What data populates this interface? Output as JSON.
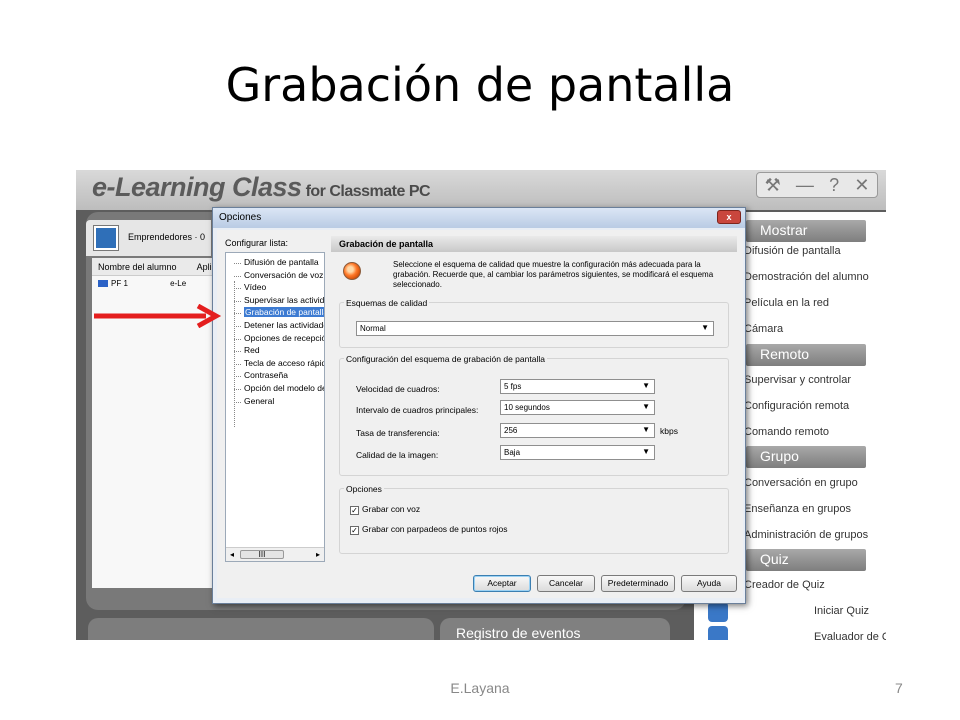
{
  "slide": {
    "title": "Grabación de pantalla",
    "author": "E.Layana",
    "page_number": "7"
  },
  "app": {
    "title_main": "e-Learning Class",
    "title_sub": "for Classmate PC",
    "controls": [
      "⚒",
      "—",
      "?",
      "✕"
    ]
  },
  "left_panel": {
    "group_label": "Emprendedores · 0",
    "columns": [
      "Nombre del alumno",
      "Apli"
    ],
    "rows": [
      {
        "name": "PF 1",
        "app": "e-Le"
      }
    ]
  },
  "bottom_tabs": {
    "events_label": "Registro de eventos"
  },
  "right_panel": {
    "sections": [
      {
        "header": "Mostrar",
        "items": [
          "Difusión de pantalla",
          "Demostración del alumno",
          "Película en la red",
          "Cámara"
        ]
      },
      {
        "header": "Remoto",
        "items": [
          "Supervisar y controlar",
          "Configuración remota",
          "Comando remoto"
        ]
      },
      {
        "header": "Grupo",
        "items": [
          "Conversación en grupo",
          "Enseñanza en grupos",
          "Administración de grupos"
        ]
      },
      {
        "header": "Quiz",
        "items": [
          "Creador de Quiz",
          "Iniciar Quiz",
          "Evaluador de Quiz"
        ]
      }
    ]
  },
  "dialog": {
    "title": "Opciones",
    "close_label": "x",
    "config_list_label": "Configurar lista:",
    "tree_items": [
      "Difusión de pantalla",
      "Conversación de voz",
      "Vídeo",
      "Supervisar las actividades",
      "Grabación de pantalla",
      "Detener las actividades",
      "Opciones de recepción",
      "Red",
      "Tecla de acceso rápido",
      "Contraseña",
      "Opción del modelo de",
      "General"
    ],
    "selected_tree_item": "Grabación de pantalla",
    "scroll_thumb": "III",
    "pane_title": "Grabación de pantalla",
    "description": "Seleccione el esquema de calidad que muestre la configuración más adecuada para la grabación. Recuerde que, al cambiar los parámetros siguientes, se modificará el esquema seleccionado.",
    "quality_group": {
      "title": "Esquemas de calidad",
      "value": "Normal"
    },
    "config_group": {
      "title": "Configuración del esquema de grabación de pantalla",
      "fields": [
        {
          "label": "Velocidad de cuadros:",
          "value": "5 fps",
          "unit": ""
        },
        {
          "label": "Intervalo de cuadros principales:",
          "value": "10 segundos",
          "unit": ""
        },
        {
          "label": "Tasa de transferencia:",
          "value": "256",
          "unit": "kbps"
        },
        {
          "label": "Calidad de la imagen:",
          "value": "Baja",
          "unit": ""
        }
      ]
    },
    "options_group": {
      "title": "Opciones",
      "checks": [
        {
          "label": "Grabar con voz",
          "checked": true
        },
        {
          "label": "Grabar con parpadeos de puntos rojos",
          "checked": true
        }
      ]
    },
    "buttons": {
      "accept": "Aceptar",
      "cancel": "Cancelar",
      "default": "Predeterminado",
      "help": "Ayuda"
    }
  },
  "colors": {
    "annotation_arrow": "#e41e1e",
    "selection": "#3d7bd2"
  }
}
